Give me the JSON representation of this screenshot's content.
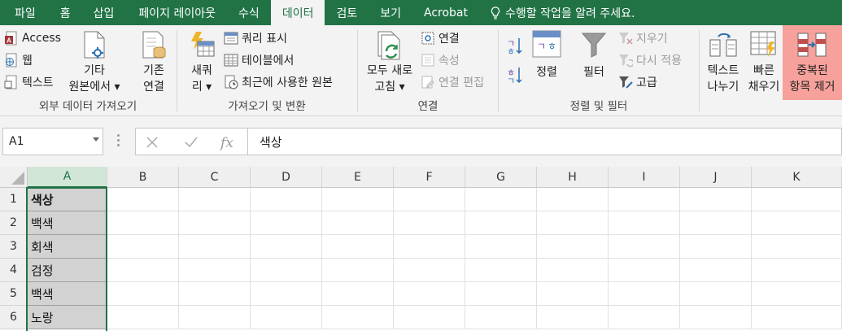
{
  "tabs": [
    {
      "label": "파일"
    },
    {
      "label": "홈"
    },
    {
      "label": "삽입"
    },
    {
      "label": "페이지 레이아웃"
    },
    {
      "label": "수식"
    },
    {
      "label": "데이터"
    },
    {
      "label": "검토"
    },
    {
      "label": "보기"
    },
    {
      "label": "Acrobat"
    }
  ],
  "active_tab": "데이터",
  "tell_me": "수행할 작업을 알려 주세요.",
  "ribbon": {
    "external": {
      "label": "외부 데이터 가져오기",
      "access": "Access",
      "web": "웹",
      "text": "텍스트",
      "other_1": "기타",
      "other_2": "원본에서",
      "existing_1": "기존",
      "existing_2": "연결"
    },
    "transform": {
      "label": "가져오기 및 변환",
      "new_1": "새쿼",
      "new_2": "리",
      "show_queries": "쿼리 표시",
      "from_table": "테이블에서",
      "recent": "최근에 사용한 원본"
    },
    "connections": {
      "label": "연결",
      "refresh_1": "모두 새로",
      "refresh_2": "고침",
      "connections": "연결",
      "properties": "속성",
      "edit_links": "연결 편집"
    },
    "sort_filter": {
      "label": "정렬 및 필터",
      "sort": "정렬",
      "filter": "필터",
      "clear": "지우기",
      "reapply": "다시 적용",
      "advanced": "고급"
    },
    "tools": {
      "text_to_col_1": "텍스트",
      "text_to_col_2": "나누기",
      "flash_1": "빠른",
      "flash_2": "채우기",
      "dup_1": "중복된",
      "dup_2": "항목 제거"
    }
  },
  "formula_bar": {
    "name_box": "A1",
    "fx": "fx",
    "content": "색상"
  },
  "columns": [
    "A",
    "B",
    "C",
    "D",
    "E",
    "F",
    "G",
    "H",
    "I",
    "J",
    "K"
  ],
  "rows": [
    {
      "num": "1",
      "value": "색상"
    },
    {
      "num": "2",
      "value": "백색"
    },
    {
      "num": "3",
      "value": "회색"
    },
    {
      "num": "4",
      "value": "검정"
    },
    {
      "num": "5",
      "value": "백색"
    },
    {
      "num": "6",
      "value": "노랑"
    }
  ],
  "colors": {
    "excel_green": "#217346",
    "highlight": "#f6a19b"
  }
}
